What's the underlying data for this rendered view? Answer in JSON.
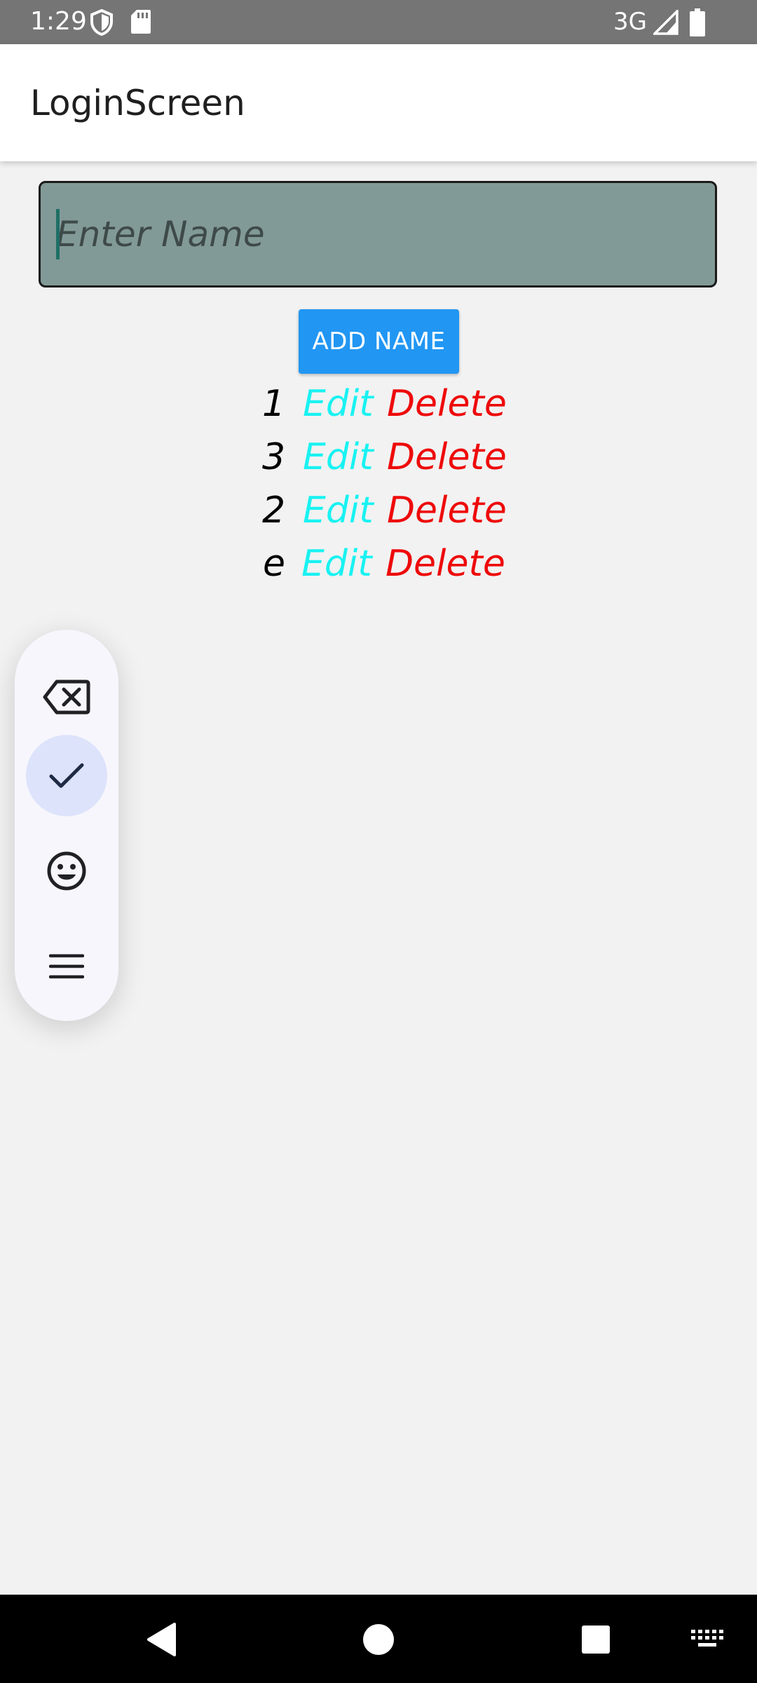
{
  "status_bar": {
    "time": "1:29",
    "network": "3G"
  },
  "app_bar": {
    "title": "LoginScreen"
  },
  "input": {
    "placeholder": "Enter Name",
    "value": ""
  },
  "add_button": {
    "label": "ADD NAME"
  },
  "list": {
    "items": [
      {
        "name": "1",
        "edit_label": "Edit",
        "delete_label": "Delete"
      },
      {
        "name": "3",
        "edit_label": "Edit",
        "delete_label": "Delete"
      },
      {
        "name": "2",
        "edit_label": "Edit",
        "delete_label": "Delete"
      },
      {
        "name": "e",
        "edit_label": "Edit",
        "delete_label": "Delete"
      }
    ]
  },
  "floating_toolbar": {
    "tools": [
      "backspace-icon",
      "check-icon",
      "emoji-icon",
      "menu-icon"
    ],
    "active_tool": "check-icon"
  },
  "colors": {
    "accent": "#2196f3",
    "edit": "#19f2f2",
    "delete": "#ee0a0a",
    "input_bg": "#829a97",
    "status_bar": "#757575"
  }
}
